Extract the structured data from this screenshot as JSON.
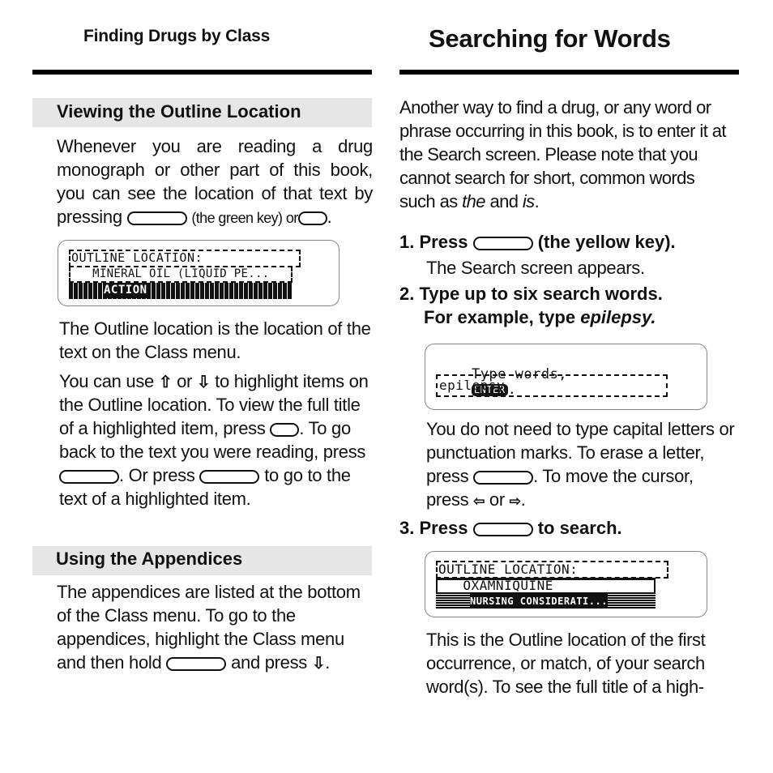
{
  "left_page": {
    "running_head": "Finding Drugs by Class",
    "sections": [
      {
        "title": "Viewing the Outline Location",
        "intro": {
          "text_before_key": "Whenever you are reading a drug monograph or other part of this book, you can see the location of that text by pressing",
          "key_1_desc": "(the green key) or",
          "end": "."
        },
        "lcd": {
          "line_1": "OUTLINE LOCATION:",
          "line_2": "   MINERAL OIL (LIQUID PE...",
          "line_3_highlight": "ACTION"
        },
        "para_2": "The Outline location is the location of the text on the Class menu.",
        "para_3": {
          "part_1": "You can use",
          "part_2": "or",
          "part_3": "to highlight items on the Outline location. To view the full title of a highlighted item, press",
          "part_4": ". To go back to the text you were reading, press",
          "part_5": ". Or press",
          "part_6": "to go to the text of a highlighted item."
        },
        "icons": {
          "up": "⇧",
          "down": "⇩"
        }
      },
      {
        "title": "Using the Appendices",
        "para": {
          "part_1": "The appendices are listed at the bottom of the Class menu. To go to the appendices, highlight the Class menu and then hold",
          "part_2": "and press",
          "part_3": "."
        }
      }
    ]
  },
  "right_page": {
    "title": "Searching for Words",
    "intro": {
      "part_1": "Another way to find a drug, or any word or phrase occurring in this book, is to enter it at the Search screen. Please note that you cannot search for short, common words such as",
      "em_1": "the",
      "part_2": "and",
      "em_2": "is",
      "part_3": "."
    },
    "steps": [
      {
        "number": "1.",
        "label_before": "Press",
        "label_after": "(the yellow key).",
        "desc": "The Search screen appears."
      },
      {
        "number": "2.",
        "label": "Type up to six search words.",
        "label_line2_before": "For example, type",
        "label_line2_em": "epilepsy."
      },
      {
        "number": "3.",
        "label_before": "Press",
        "label_after": "to search."
      }
    ],
    "search_lcd": {
      "prompt": "Type words,",
      "badge": "ENTER",
      "prompt_end": ".",
      "input_value": "epilepsy"
    },
    "step2_desc": {
      "part_1": "You do not need to type capital letters or punctuation marks. To erase a letter, press",
      "part_2": ". To move the cursor, press",
      "part_3": "or",
      "part_4": "."
    },
    "arrows": {
      "left": "⇦",
      "right": "⇨"
    },
    "result_lcd": {
      "line_1": "OUTLINE LOCATION:",
      "line_2": "   OXAMNIQUINE",
      "line_3_highlight": "NURSING CONSIDERATI..."
    },
    "closing": "This is the Outline location of the first occurrence, or match, of your search word(s). To see the full title of a high-"
  }
}
